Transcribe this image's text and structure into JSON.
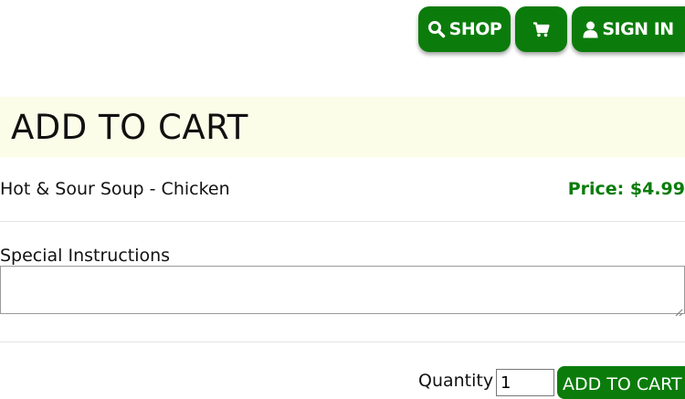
{
  "nav": {
    "shop_label": "SHOP",
    "signin_label": "SIGN IN",
    "shop_icon": "search-icon",
    "cart_icon": "cart-icon",
    "signin_icon": "user-icon"
  },
  "banner": {
    "title": "ADD TO CART"
  },
  "item": {
    "name": "Hot & Sour Soup - Chicken",
    "price": "Price: $4.99"
  },
  "instructions": {
    "label": "Special Instructions",
    "value": ""
  },
  "quantity": {
    "label": "Quantity",
    "value": "1"
  },
  "add_button_label": "ADD TO CART",
  "colors": {
    "accent": "#0b7c0b",
    "banner_bg": "#fcfde8",
    "rule": "#e4e4e4"
  }
}
